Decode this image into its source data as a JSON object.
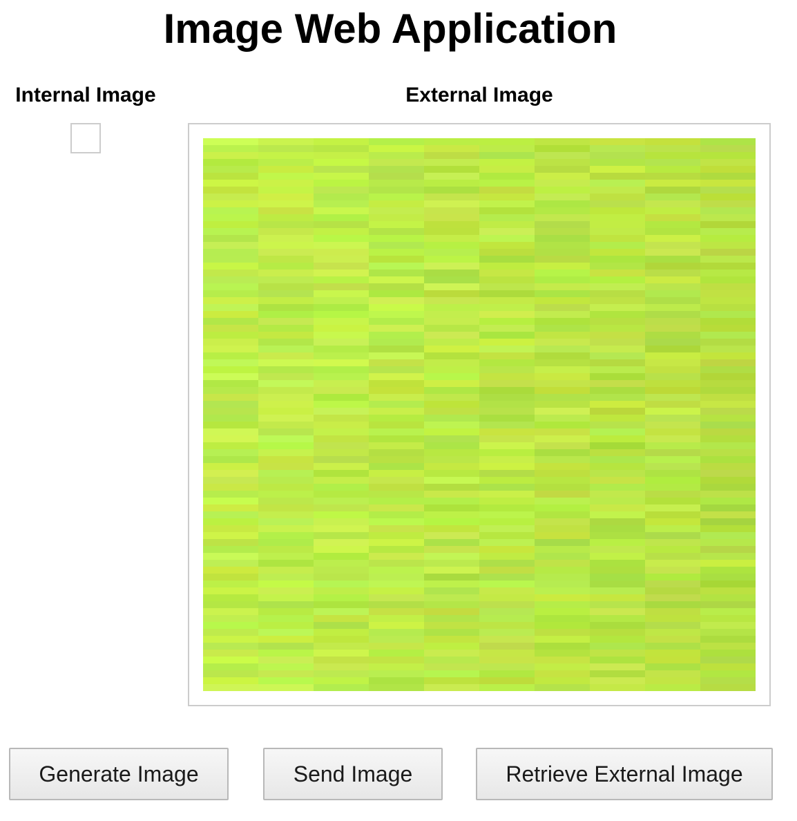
{
  "app": {
    "title": "Image Web Application"
  },
  "internal_panel": {
    "heading": "Internal Image"
  },
  "external_panel": {
    "heading": "External Image"
  },
  "actions": {
    "generate_label": "Generate Image",
    "send_label": "Send Image",
    "retrieve_label": "Retrieve External Image"
  },
  "colors": {
    "image_base": "#b8f04a",
    "frame_border": "#cccccc"
  }
}
